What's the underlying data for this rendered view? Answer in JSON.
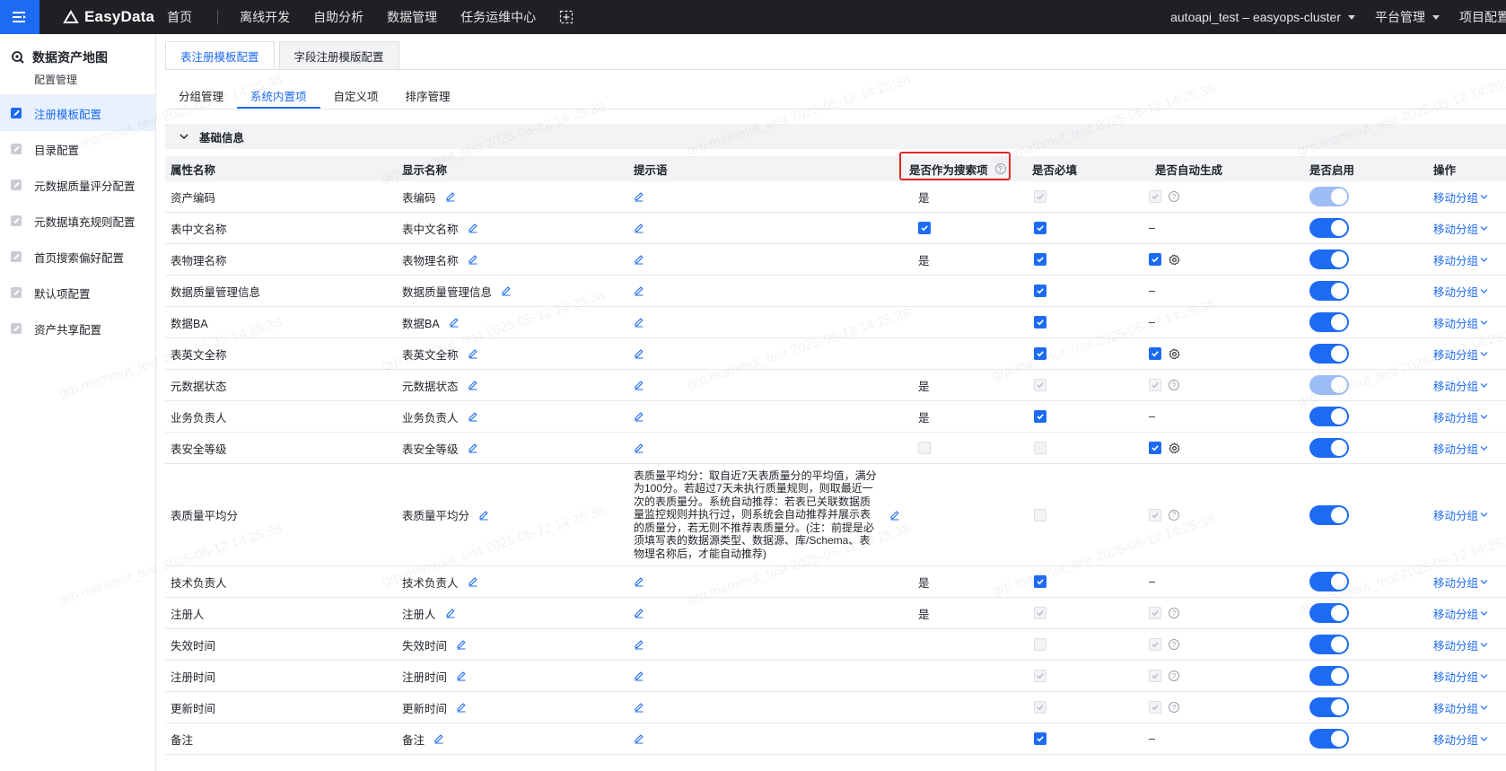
{
  "topbar": {
    "logo_text": "EasyData",
    "nav": [
      "首页",
      "离线开发",
      "自助分析",
      "数据管理",
      "任务运维中心"
    ],
    "project": "autoapi_test – easyops-cluster",
    "platform": "平台管理",
    "project_config": "项目配置"
  },
  "sidebar": {
    "title": "数据资产地图",
    "subtitle": "配置管理",
    "items": [
      {
        "label": "注册模板配置",
        "active": true
      },
      {
        "label": "目录配置",
        "active": false
      },
      {
        "label": "元数据质量评分配置",
        "active": false
      },
      {
        "label": "元数据填充规则配置",
        "active": false
      },
      {
        "label": "首页搜索偏好配置",
        "active": false
      },
      {
        "label": "默认项配置",
        "active": false
      },
      {
        "label": "资产共享配置",
        "active": false
      }
    ]
  },
  "tabs_primary": [
    "表注册模板配置",
    "字段注册模版配置"
  ],
  "tabs_secondary": [
    "分组管理",
    "系统内置项",
    "自定义项",
    "排序管理"
  ],
  "section_title": "基础信息",
  "watermark_text": "grp.mammut_test 2025-05-12 14:25:38",
  "table": {
    "headers": [
      "属性名称",
      "显示名称",
      "提示语",
      "是否作为搜索项",
      "是否必填",
      "是否自动生成",
      "是否启用",
      "操作"
    ],
    "action_label": "移动分组",
    "rows": [
      {
        "attr": "资产编码",
        "display": "表编码",
        "hint": "",
        "search": "是",
        "required": "dis-on",
        "auto": "dis-on-q",
        "enabled": "dis"
      },
      {
        "attr": "表中文名称",
        "display": "表中文名称",
        "hint": "",
        "search": "cb-on",
        "required": "on",
        "auto": "dash",
        "enabled": "on"
      },
      {
        "attr": "表物理名称",
        "display": "表物理名称",
        "hint": "",
        "search": "是",
        "required": "on",
        "auto": "on-gear",
        "enabled": "on"
      },
      {
        "attr": "数据质量管理信息",
        "display": "数据质量管理信息",
        "hint": "",
        "search": "",
        "required": "on",
        "auto": "dash",
        "enabled": "on"
      },
      {
        "attr": "数据BA",
        "display": "数据BA",
        "hint": "",
        "search": "",
        "required": "on",
        "auto": "dash",
        "enabled": "on"
      },
      {
        "attr": "表英文全称",
        "display": "表英文全称",
        "hint": "",
        "search": "",
        "required": "on",
        "auto": "on-gear",
        "enabled": "on"
      },
      {
        "attr": "元数据状态",
        "display": "元数据状态",
        "hint": "",
        "search": "是",
        "required": "dis-on",
        "auto": "dis-on-q",
        "enabled": "dis"
      },
      {
        "attr": "业务负责人",
        "display": "业务负责人",
        "hint": "",
        "search": "是",
        "required": "on",
        "auto": "dash",
        "enabled": "on"
      },
      {
        "attr": "表安全等级",
        "display": "表安全等级",
        "hint": "",
        "search": "cb-off",
        "required": "dis-off",
        "auto": "on-gear",
        "enabled": "on"
      },
      {
        "attr": "表质量平均分",
        "display": "表质量平均分",
        "hint": "表质量平均分：取自近7天表质量分的平均值，满分为100分。若超过7天未执行质量规则，则取最近一次的表质量分。系统自动推荐：若表已关联数据质量监控规则并执行过，则系统会自动推荐并展示表的质量分，若无则不推荐表质量分。(注：前提是必须填写表的数据源类型、数据源、库/Schema、表物理名称后，才能自动推荐)",
        "search": "",
        "required": "dis-off",
        "auto": "dis-on-q",
        "enabled": "on"
      },
      {
        "attr": "技术负责人",
        "display": "技术负责人",
        "hint": "",
        "search": "是",
        "required": "on",
        "auto": "dash",
        "enabled": "on"
      },
      {
        "attr": "注册人",
        "display": "注册人",
        "hint": "",
        "search": "是",
        "required": "dis-on",
        "auto": "dis-on-q",
        "enabled": "on"
      },
      {
        "attr": "失效时间",
        "display": "失效时间",
        "hint": "",
        "search": "",
        "required": "dis-off",
        "auto": "dis-on-q",
        "enabled": "on"
      },
      {
        "attr": "注册时间",
        "display": "注册时间",
        "hint": "",
        "search": "",
        "required": "dis-on",
        "auto": "dis-on-q",
        "enabled": "on"
      },
      {
        "attr": "更新时间",
        "display": "更新时间",
        "hint": "",
        "search": "",
        "required": "dis-on",
        "auto": "dis-on-q",
        "enabled": "on"
      },
      {
        "attr": "备注",
        "display": "备注",
        "hint": "",
        "search": "",
        "required": "on",
        "auto": "dash",
        "enabled": "on"
      }
    ]
  },
  "colors": {
    "accent": "#1d6bf2",
    "topbar": "#1f1f24",
    "highlight": "#e32626"
  }
}
